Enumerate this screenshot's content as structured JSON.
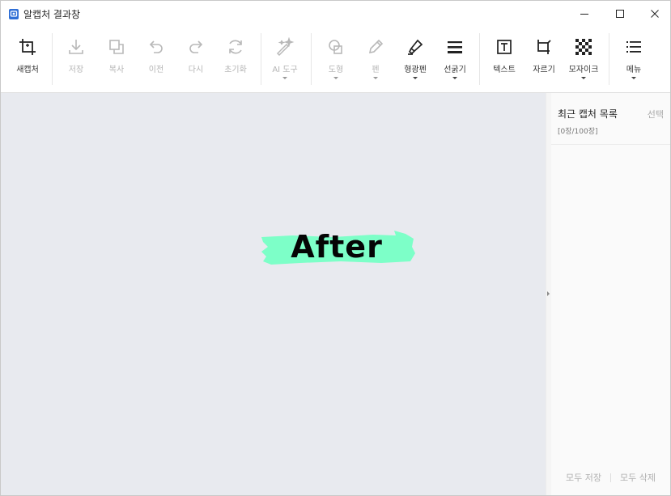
{
  "window": {
    "title": "알캡처 결과창"
  },
  "toolbar": {
    "new_capture": "새캡처",
    "save": "저장",
    "copy": "복사",
    "undo": "이전",
    "redo": "다시",
    "reset": "초기화",
    "ai_tools": "AI 도구",
    "shape": "도형",
    "pen": "펜",
    "highlighter": "형광펜",
    "line_thickness": "선굵기",
    "text": "텍스트",
    "crop": "자르기",
    "mosaic": "모자이크",
    "menu": "메뉴"
  },
  "canvas": {
    "image_text": "After",
    "highlight_color": "#7dffc8",
    "background": "#e8eaef"
  },
  "panel": {
    "title": "최근 캡처 목록",
    "select": "선택",
    "count": "[0장/100장]",
    "save_all": "모두 저장",
    "delete_all": "모두 삭제"
  }
}
